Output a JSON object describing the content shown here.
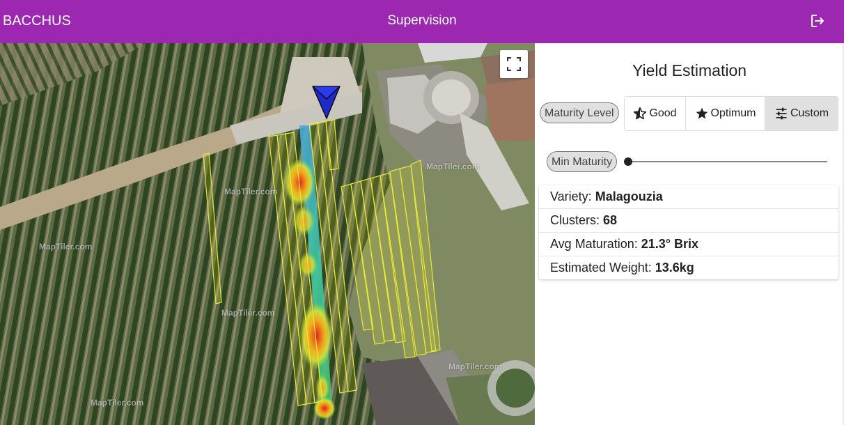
{
  "appbar": {
    "brand": "BACCHUS",
    "title": "Supervision",
    "logout_icon": "logout-icon",
    "color": "#9c27b0"
  },
  "map": {
    "watermark": "MapTiler.com",
    "fullscreen_icon": "fullscreen-icon",
    "marker_icon": "navigation-arrow-icon"
  },
  "panel": {
    "title": "Yield Estimation",
    "maturity_label": "Maturity Level",
    "maturity_options": [
      {
        "label": "Good",
        "icon": "half-star-icon",
        "selected": false
      },
      {
        "label": "Optimum",
        "icon": "star-icon",
        "selected": false
      },
      {
        "label": "Custom",
        "icon": "tune-icon",
        "selected": true
      }
    ],
    "min_maturity_label": "Min Maturity",
    "min_maturity_value": 0,
    "info": {
      "variety_label": "Variety:",
      "variety_value": "Malagouzia",
      "clusters_label": "Clusters:",
      "clusters_value": "68",
      "maturation_label": "Avg Maturation:",
      "maturation_value": "21.3° Brix",
      "weight_label": "Estimated Weight:",
      "weight_value": "13.6kg"
    }
  }
}
